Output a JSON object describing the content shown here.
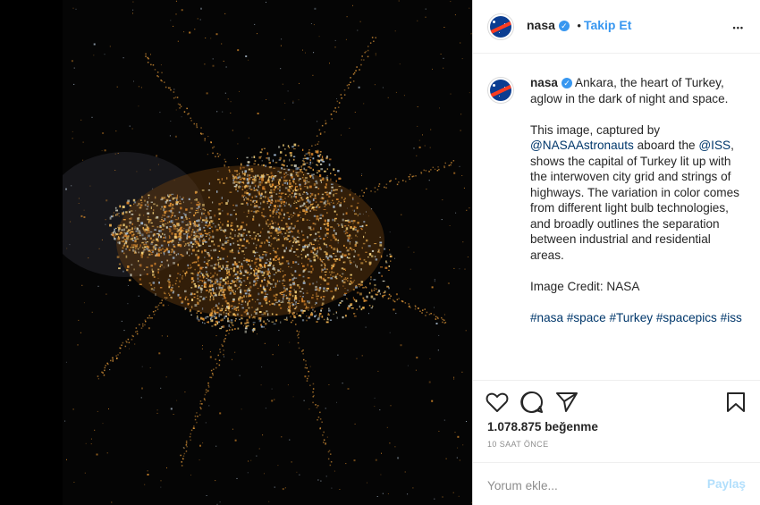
{
  "post": {
    "username": "nasa",
    "verified_glyph": "✓",
    "follow_separator": "•",
    "follow_label": "Takip Et",
    "more_label": "•••",
    "avatar_mark": "NASA",
    "image_alt_icon": "night-city-photo"
  },
  "caption": {
    "username": "nasa",
    "lead": "Ankara, the heart of Turkey, aglow in the dark of night and space.",
    "p2_before": "This image, captured by ",
    "mention_1": "@NASAAstronauts",
    "p2_mid": " aboard the ",
    "mention_2": "@ISS",
    "p2_after": ", shows the capital of Turkey lit up with the interwoven city grid and strings of highways. The variation in color comes from different light bulb technologies, and broadly outlines the separation between industrial and residential areas.",
    "credit": "Image Credit: NASA",
    "hashtags": [
      "#nasa",
      "#space",
      "#Turkey",
      "#spacepics",
      "#iss"
    ]
  },
  "stats": {
    "likes": "1.078.875 beğenme",
    "time_ago": "10 SAAT ÖNCE"
  },
  "comment": {
    "placeholder": "Yorum ekle...",
    "share_label": "Paylaş"
  },
  "icons": {
    "like": "heart-icon",
    "comment": "comment-icon",
    "share": "send-icon",
    "save": "bookmark-icon"
  },
  "colors": {
    "accent": "#3897f0",
    "city_light": "#d98b2b",
    "link": "#00376b"
  }
}
